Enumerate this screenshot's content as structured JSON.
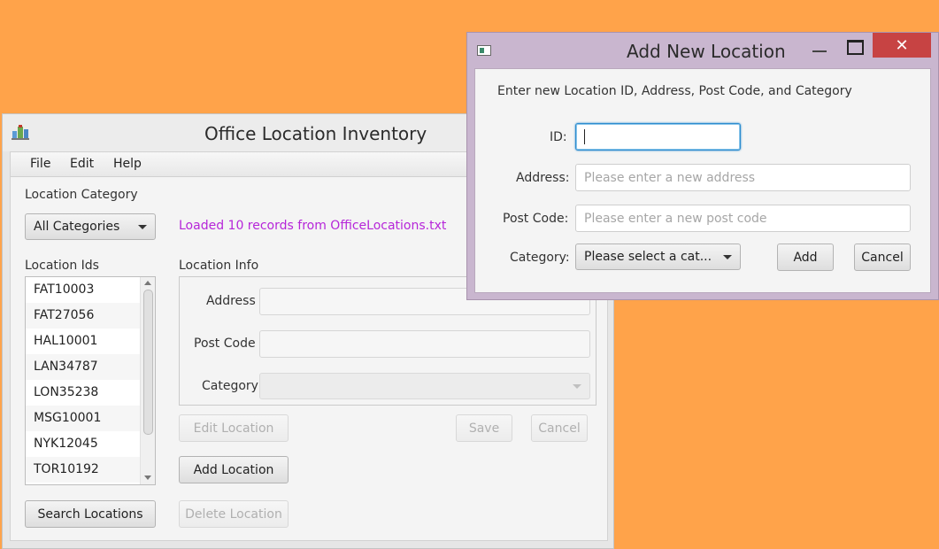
{
  "main_window": {
    "title": "Office Location Inventory",
    "menu": [
      "File",
      "Edit",
      "Help"
    ],
    "category_label": "Location Category",
    "category_value": "All Categories",
    "status_message": "Loaded 10 records from OfficeLocations.txt",
    "status_color": "#b626d9",
    "ids_label": "Location Ids",
    "location_ids": [
      "FAT10003",
      "FAT27056",
      "HAL10001",
      "LAN34787",
      "LON35238",
      "MSG10001",
      "NYK12045",
      "TOR10192"
    ],
    "info_label": "Location Info",
    "address_label": "Address",
    "address_value": "",
    "postcode_label": "Post Code",
    "postcode_value": "",
    "category_field_label": "Category",
    "category_field_value": "",
    "edit_button": "Edit Location",
    "save_button": "Save",
    "cancel_button": "Cancel",
    "add_button": "Add Location",
    "search_button": "Search Locations",
    "delete_button": "Delete Location"
  },
  "dialog": {
    "title": "Add New Location",
    "instructions": "Enter new Location ID, Address, Post Code, and Category",
    "id_label": "ID:",
    "id_value": "",
    "address_label": "Address:",
    "address_placeholder": "Please enter a new address",
    "postcode_label": "Post Code:",
    "postcode_placeholder": "Please enter a new post code",
    "category_label": "Category:",
    "category_value": "Please select a cat...",
    "add_button": "Add",
    "cancel_button": "Cancel",
    "close_glyph": "✕"
  },
  "colors": {
    "desktop": "#FFA34A",
    "dialog_frame": "#c9b6cf",
    "close_button": "#c74343",
    "focus": "#2c8ccf"
  }
}
